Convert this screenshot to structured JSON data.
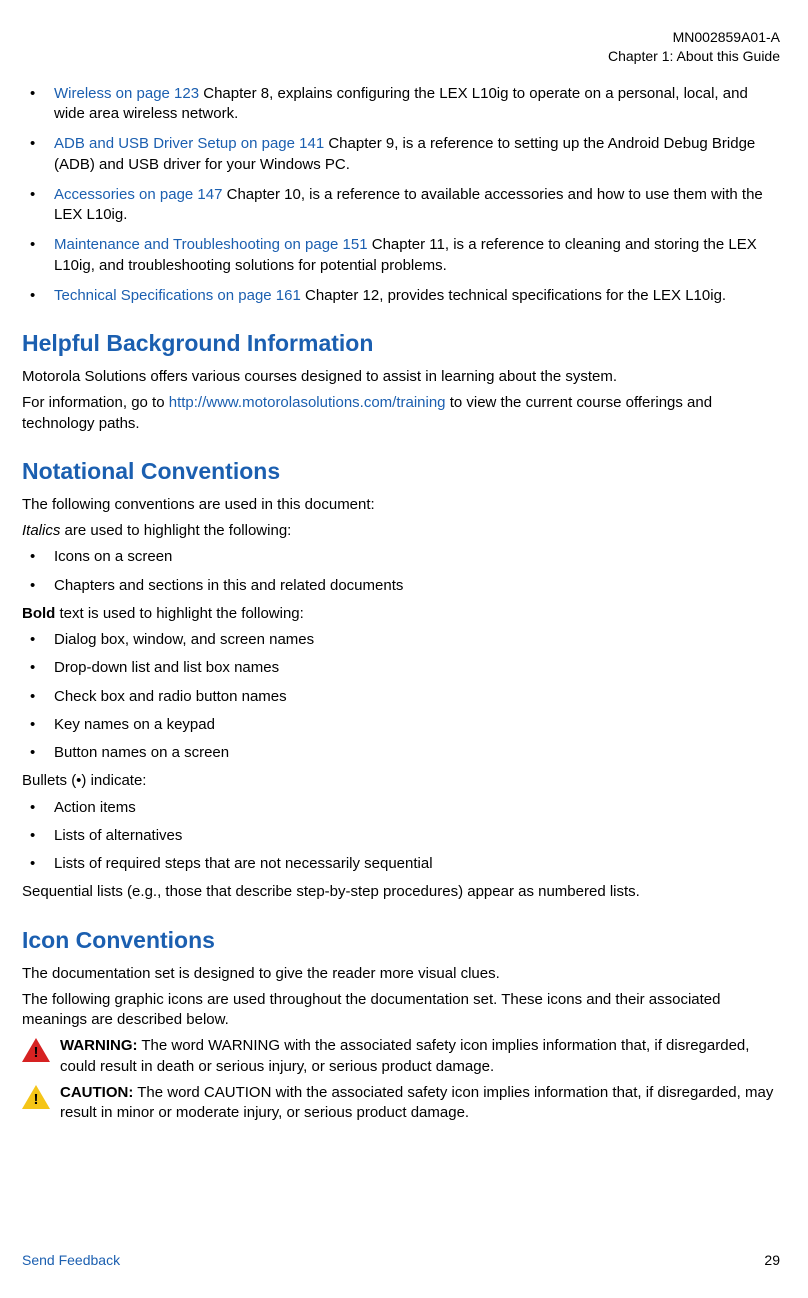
{
  "header": {
    "doc_id": "MN002859A01-A",
    "chapter_line": "Chapter 1:  About this Guide"
  },
  "top_bullets": [
    {
      "link": "Wireless on page 123",
      "rest": " Chapter 8, explains configuring the LEX L10ig to operate on a personal, local, and wide area wireless network."
    },
    {
      "link": "ADB and USB Driver Setup on page 141",
      "rest": " Chapter 9, is a reference to setting up the Android Debug Bridge (ADB) and USB driver for your Windows PC."
    },
    {
      "link": "Accessories on page 147",
      "rest": " Chapter 10, is a reference to available accessories and how to use them with the LEX L10ig."
    },
    {
      "link": "Maintenance and Troubleshooting on page 151",
      "rest": " Chapter 11, is a reference to cleaning and storing the LEX L10ig, and troubleshooting solutions for potential problems."
    },
    {
      "link": "Technical Specifications on page 161",
      "rest": " Chapter 12, provides technical specifications for the LEX L10ig."
    }
  ],
  "helpful": {
    "heading": "Helpful Background Information",
    "p1": "Motorola Solutions offers various courses designed to assist in learning about the system.",
    "p2_pre": "For information, go to ",
    "p2_link": "http://www.motorolasolutions.com/training",
    "p2_post": " to view the current course offerings and technology paths."
  },
  "notational": {
    "heading": "Notational Conventions",
    "intro": "The following conventions are used in this document:",
    "italics_word": "Italics",
    "italics_line_rest": " are used to highlight the following:",
    "italics_items": [
      "Icons on a screen",
      "Chapters and sections in this and related documents"
    ],
    "bold_word": "Bold",
    "bold_line_rest": " text is used to highlight the following:",
    "bold_items": [
      "Dialog box, window, and screen names",
      "Drop-down list and list box names",
      "Check box and radio button names",
      "Key names on a keypad",
      "Button names on a screen"
    ],
    "bullets_line": "Bullets (•) indicate:",
    "bullets_items": [
      "Action items",
      "Lists of alternatives",
      "Lists of required steps that are not necessarily sequential"
    ],
    "seq_line": "Sequential lists (e.g., those that describe step-by-step procedures) appear as numbered lists."
  },
  "iconconv": {
    "heading": "Icon Conventions",
    "p1": "The documentation set is designed to give the reader more visual clues.",
    "p2": "The following graphic icons are used throughout the documentation set. These icons and their associated meanings are described below.",
    "warning_label": "WARNING:",
    "warning_text": " The word WARNING with the associated safety icon implies information that, if disregarded, could result in death or serious injury, or serious product damage.",
    "caution_label": "CAUTION:",
    "caution_text": " The word CAUTION with the associated safety icon implies information that, if disregarded, may result in minor or moderate injury, or serious product damage."
  },
  "footer": {
    "send_feedback": "Send Feedback",
    "page_num": "29"
  }
}
